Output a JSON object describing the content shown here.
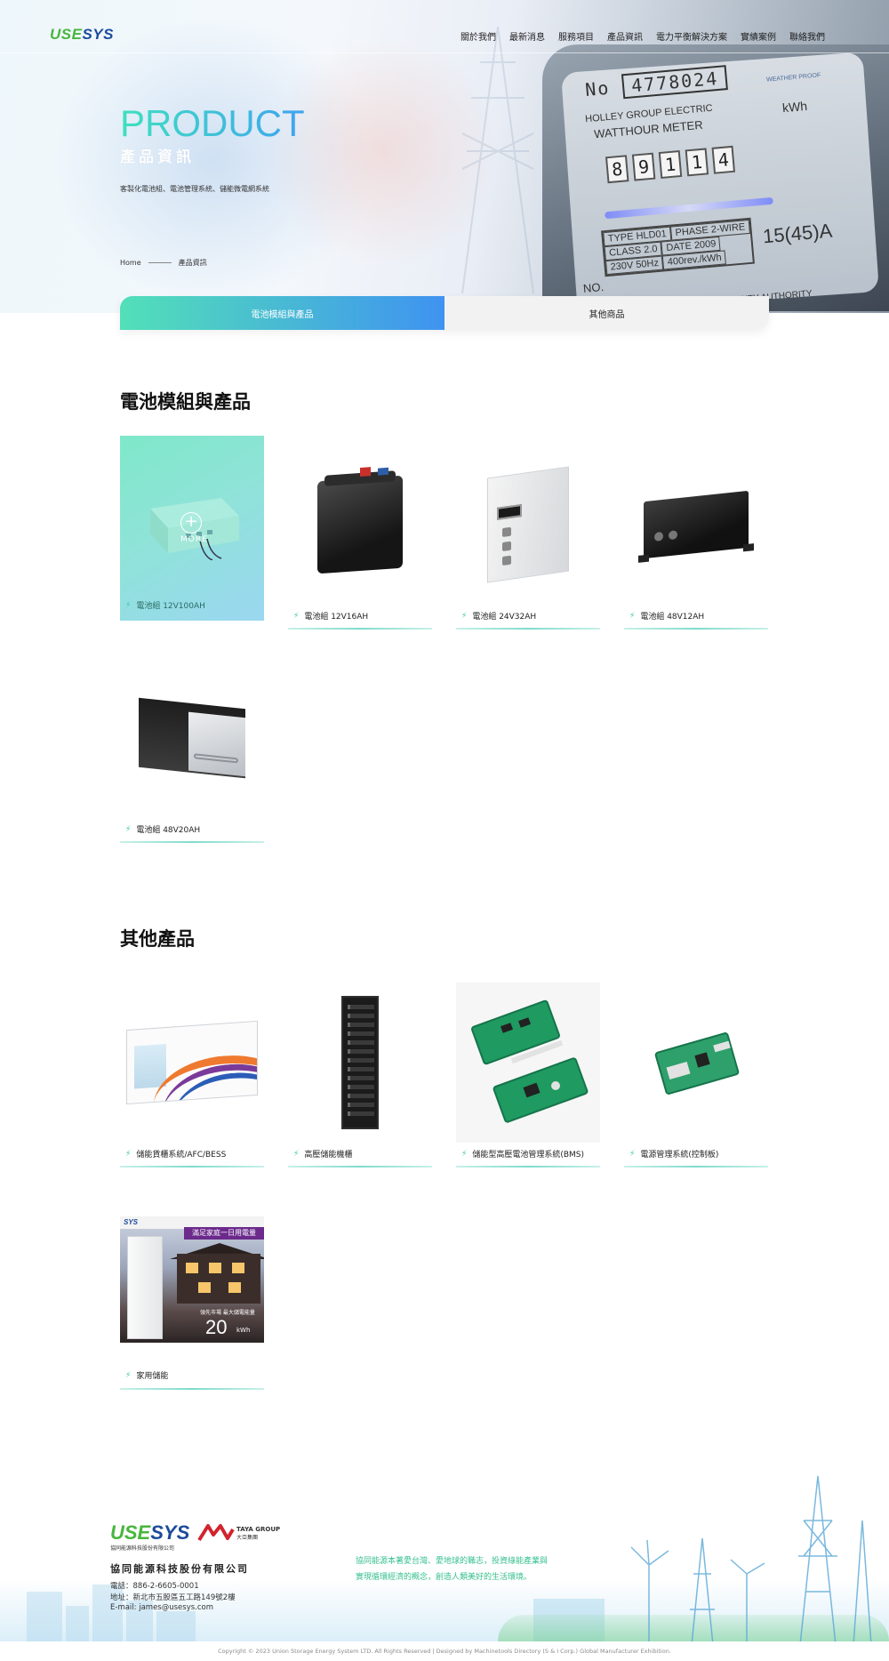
{
  "brand": {
    "logo_part1": "USE",
    "logo_part2": "SYS"
  },
  "nav": {
    "items": [
      "關於我們",
      "最新消息",
      "服務項目",
      "產品資訊",
      "電力平衡解決方案",
      "實績案例",
      "聯絡我們"
    ]
  },
  "hero": {
    "title": "PRODUCT",
    "subtitle": "產品資訊",
    "description": "客製化電池組、電池管理系統、儲能微電網系統",
    "meter": {
      "number_label": "No",
      "number": "4778024",
      "brand_line1": "HOLLEY GROUP ELECTRIC",
      "brand_line2": "WATTHOUR METER",
      "kwh": "kWh",
      "weather": "WEATHER PROOF",
      "digits": [
        "8",
        "9",
        "1",
        "1",
        "4"
      ],
      "table": [
        [
          "TYPE HLD01",
          "PHASE 2-WIRE"
        ],
        [
          "CLASS 2.0",
          "DATE 2009"
        ],
        [
          "230V 50Hz",
          "400rev./kWh"
        ]
      ],
      "amp": "15(45)A",
      "no_label": "NO.",
      "supplier": "SUPPLIED  METROPOLITAN ELECTRICITY AUTHORITY"
    }
  },
  "breadcrumb": {
    "home": "Home",
    "current": "產品資訊"
  },
  "tabs": [
    {
      "label": "電池模組與產品",
      "active": true
    },
    {
      "label": "其他商品",
      "active": false
    }
  ],
  "sections": {
    "battery": {
      "title": "電池模組與產品",
      "more_label": "MORE",
      "products": [
        "電池組 12V100AH",
        "電池組 12V16AH",
        "電池組 24V32AH",
        "電池組 48V12AH",
        "電池組 48V20AH"
      ]
    },
    "other": {
      "title": "其他產品",
      "products": [
        "儲能貨櫃系統/AFC/BESS",
        "高壓儲能機櫃",
        "儲能型高壓電池管理系統(BMS)",
        "電源管理系統(控制板)",
        "家用儲能"
      ],
      "home_ess": {
        "banner": "滿足家庭一日用電量",
        "tagline": "領先市場  最大儲電能量",
        "capacity": "20",
        "unit": "kWh"
      }
    }
  },
  "footer": {
    "logo_sub": "協同能源科技股份有限公司",
    "partner_name": "TAYA GROUP",
    "partner_sub": "大亞集團",
    "company": "協同能源科技股份有限公司",
    "phone": "電話：886-2-6605-0001",
    "address": "地址：新北市五股區五工路149號2樓",
    "email": "E-mail: james@usesys.com",
    "slogan_line1": "協同能源本著愛台灣、愛地球的職志，投資綠能產業與",
    "slogan_line2": "實現循環經濟的概念，創造人類美好的生活環境。",
    "copyright": "Copyright © 2023 Union Storage Energy System LTD. All Rights Reserved | Designed by Machinetools Directory (S & I Corp.) Global Manufacturer Exhibition."
  },
  "colors": {
    "accent_green": "#48b63d",
    "accent_blue": "#1b4b9a",
    "tab_gradient_start": "#52e0b8",
    "tab_gradient_end": "#3f93f0",
    "bolt": "#34c3a5"
  }
}
